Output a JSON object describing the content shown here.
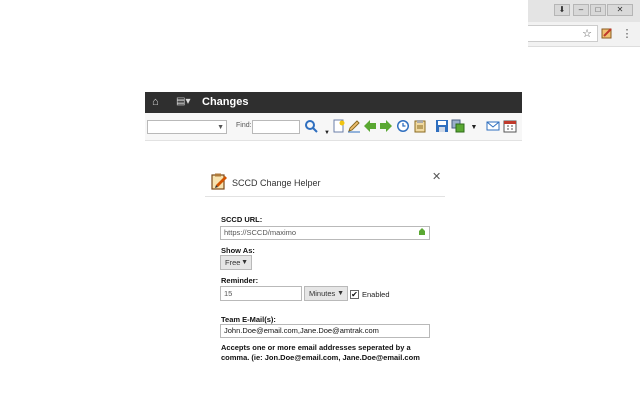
{
  "app": {
    "title": "Changes"
  },
  "toolbar": {
    "find_label": "Find:"
  },
  "dialog": {
    "title": "SCCD Change Helper",
    "url_label": "SCCD URL:",
    "url_value": "https://SCCD/maximo",
    "show_as_label": "Show As:",
    "show_as_value": "Free",
    "reminder_label": "Reminder:",
    "reminder_value": "15",
    "reminder_unit": "Minutes",
    "enabled_label": "Enabled",
    "enabled_checked": true,
    "team_email_label": "Team E-Mail(s):",
    "team_email_value": "John.Doe@email.com,Jane.Doe@amtrak.com",
    "help_text": "Accepts one or more email addresses seperated by a comma. (ie: Jon.Doe@email.com, Jane.Doe@email.com"
  },
  "icons": {
    "accent_green": "#5aa832",
    "accent_blue": "#2f6fbf",
    "accent_red": "#c0392b"
  }
}
